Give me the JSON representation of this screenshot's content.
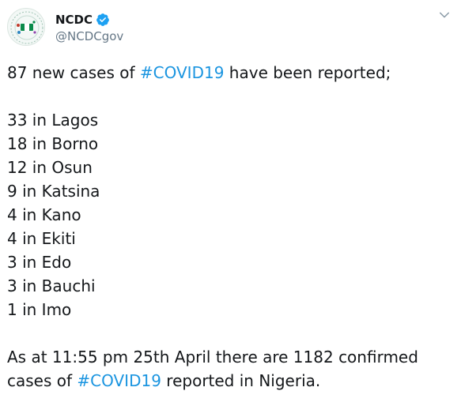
{
  "account": {
    "display_name": "NCDC",
    "handle": "@NCDCgov",
    "verified": true,
    "avatar_icon": "ncdc-logo-icon"
  },
  "menu_icon": "chevron-down-icon",
  "colors": {
    "hashtag": "#1b95e0",
    "text": "#14171a",
    "handle": "#657786",
    "verified_badge": "#1da1f2"
  },
  "tweet": {
    "intro_before": "87 new cases of ",
    "intro_hashtag": "#COVID19",
    "intro_after": " have been reported;",
    "cases": [
      "33 in Lagos",
      "18 in Borno",
      "12 in Osun",
      "9 in Katsina",
      "4 in Kano",
      "4 in Ekiti",
      "3 in Edo",
      "3 in Bauchi",
      "1 in Imo"
    ],
    "summary_line1": "As at 11:55 pm 25th April there are 1182 confirmed",
    "summary_before": "cases of ",
    "summary_hashtag": "#COVID19",
    "summary_after": " reported in Nigeria."
  }
}
